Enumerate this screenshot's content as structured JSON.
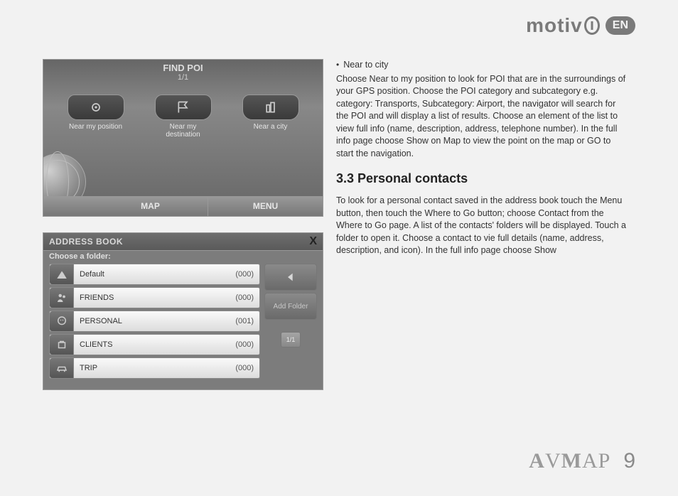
{
  "header": {
    "brand": "motiv",
    "lang": "EN"
  },
  "shot1": {
    "title": "FIND POI",
    "page": "1/1",
    "buttons": [
      {
        "label": "Near my position"
      },
      {
        "label": "Near my\ndestination"
      },
      {
        "label": "Near a city"
      }
    ],
    "bottom": {
      "map": "MAP",
      "menu": "MENU"
    }
  },
  "shot2": {
    "title": "ADDRESS BOOK",
    "subtitle": "Choose a folder:",
    "close": "X",
    "folders": [
      {
        "name": "Default",
        "count": "(000)"
      },
      {
        "name": "FRIENDS",
        "count": "(000)"
      },
      {
        "name": "PERSONAL",
        "count": "(001)"
      },
      {
        "name": "CLIENTS",
        "count": "(000)"
      },
      {
        "name": "TRIP",
        "count": "(000)"
      }
    ],
    "add_folder": "Add Folder",
    "small_page": "1/1"
  },
  "text": {
    "bullet1": "Near to city",
    "para1": "Choose Near to my position to look for POI that are in the surroundings of your GPS position. Choose the POI category and subcategory e.g. category: Transports, Subcategory: Airport, the navigator will search for the POI and will display a list of results. Choose an element of the list to view full info (name, description, address, telephone number). In the full info page choose Show on Map to view the point on the map or GO to start the navigation.",
    "heading": "3.3 Personal contacts",
    "para2": "To look for a personal contact saved in the address book touch the Menu button, then touch the Where to Go button; choose Contact from the Where to Go page. A list of the contacts' folders will be displayed. Touch a folder to open it. Choose a contact to vie full details (name, address, description, and icon). In the full info page choose Show"
  },
  "footer": {
    "brand_a": "A",
    "brand_v": "V",
    "brand_m": "M",
    "brand_ap": "AP",
    "page": "9"
  }
}
